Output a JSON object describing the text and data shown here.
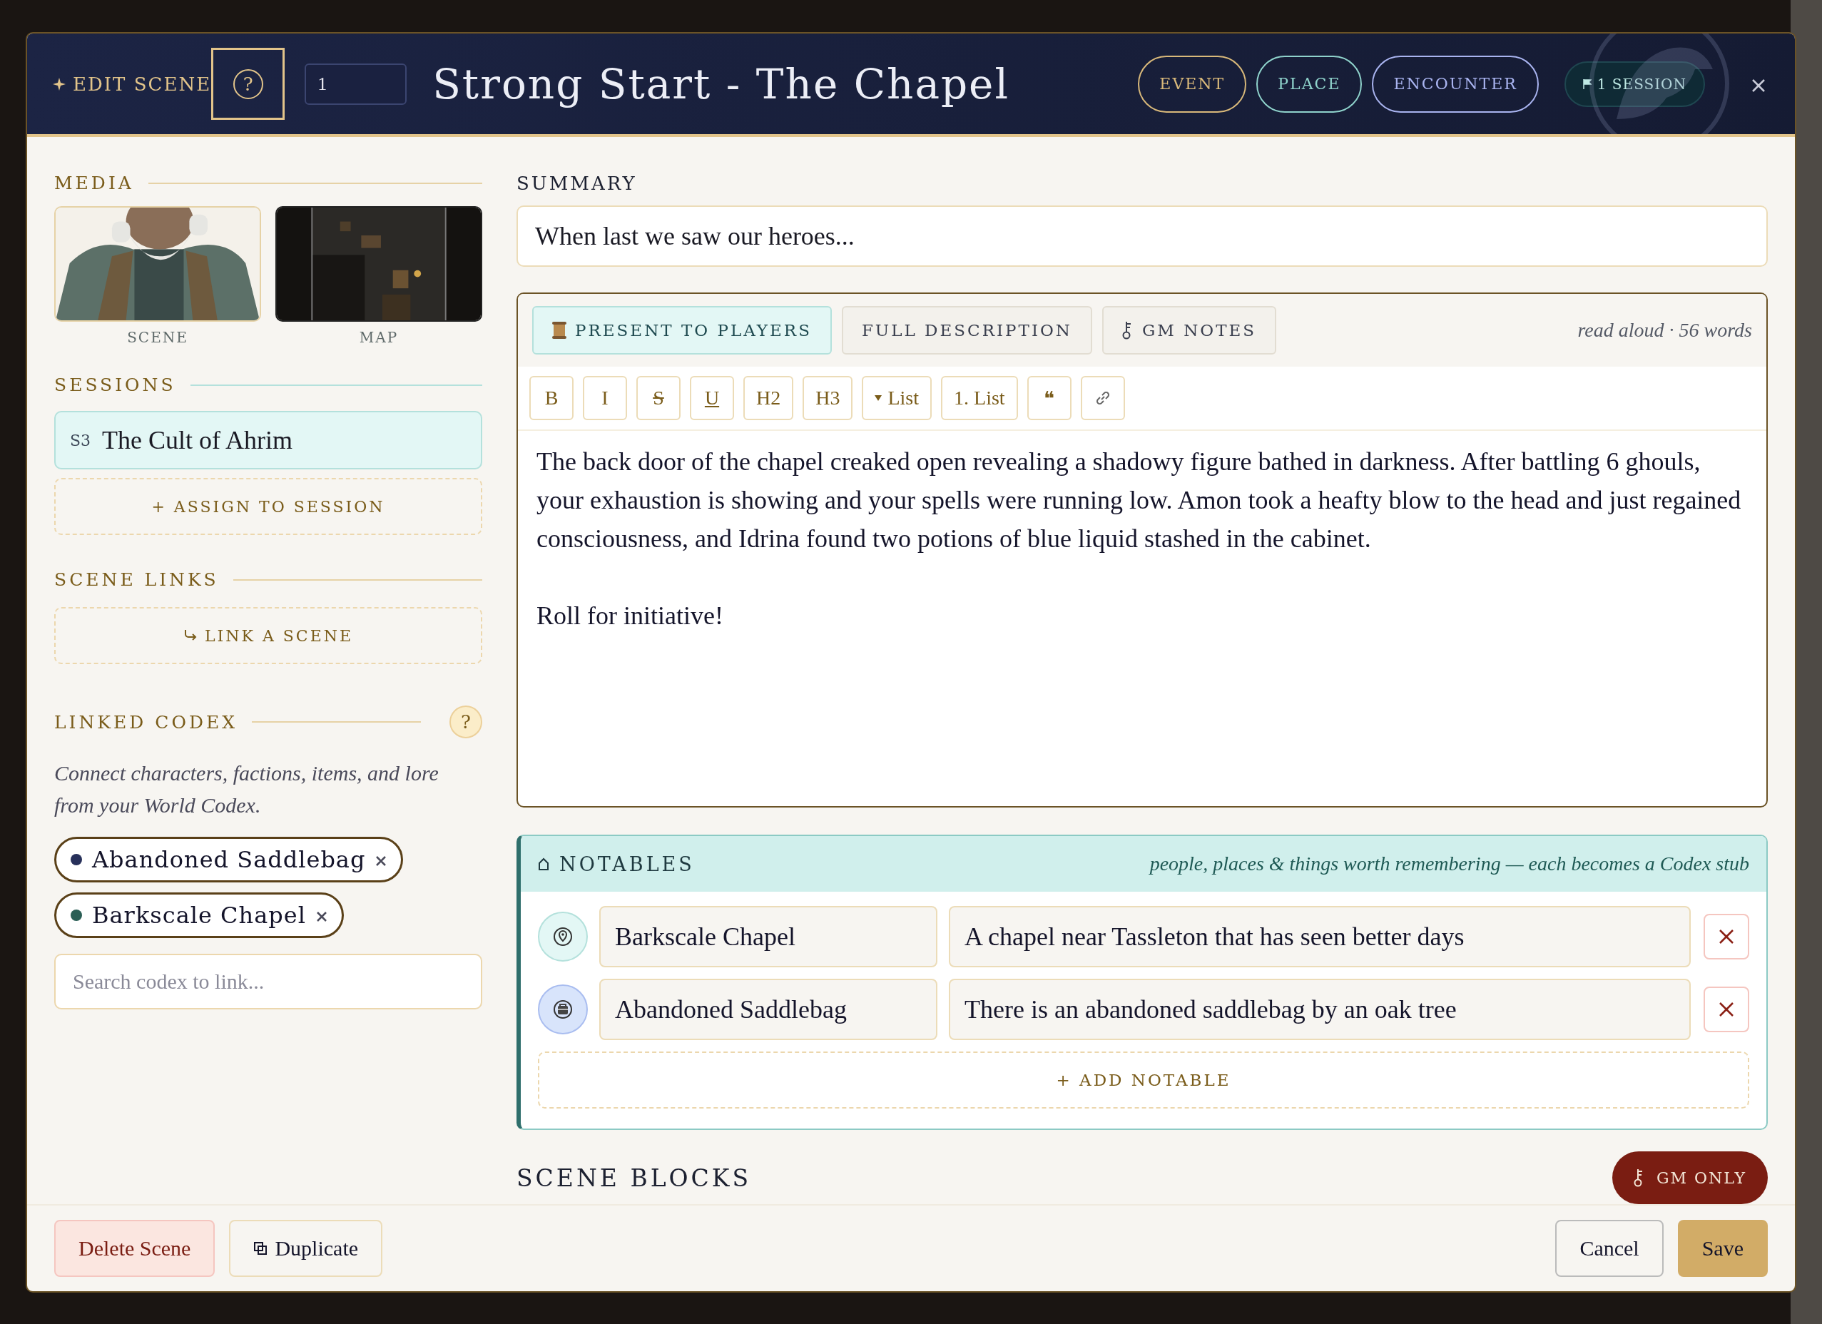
{
  "header": {
    "label": "EDIT SCENE",
    "help": "?",
    "scene_number": "1",
    "title": "Strong Start - The Chapel",
    "tags": [
      {
        "label": "EVENT",
        "color": "#d9b97a"
      },
      {
        "label": "PLACE",
        "color": "#8fd3cc"
      },
      {
        "label": "ENCOUNTER",
        "color": "#a9b4f0"
      }
    ],
    "session_badge": "1 SESSION"
  },
  "media": {
    "title": "MEDIA",
    "items": [
      {
        "caption": "SCENE",
        "kind": "portrait"
      },
      {
        "caption": "MAP",
        "kind": "map"
      }
    ]
  },
  "sessions": {
    "title": "SESSIONS",
    "items": [
      {
        "number": "S3",
        "name": "The Cult of Ahrim"
      }
    ],
    "assign_button": "+ ASSIGN TO SESSION"
  },
  "scene_links": {
    "title": "SCENE LINKS",
    "button": "LINK A SCENE"
  },
  "linked_codex": {
    "title": "LINKED CODEX",
    "help": "?",
    "description": "Connect characters, factions, items, and lore from your World Codex.",
    "chips": [
      {
        "label": "Abandoned Saddlebag",
        "color": "#27305a"
      },
      {
        "label": "Barkscale Chapel",
        "color": "#2a5e55"
      }
    ],
    "search": {
      "placeholder": "Search codex to link..."
    }
  },
  "summary": {
    "label": "SUMMARY",
    "value": "When last we saw our heroes..."
  },
  "editor": {
    "tabs": [
      {
        "label": "PRESENT TO PLAYERS",
        "kind": "scroll",
        "selected": true
      },
      {
        "label": "FULL DESCRIPTION",
        "selected": false
      },
      {
        "label": "GM NOTES",
        "kind": "key",
        "selected": false
      }
    ],
    "meta": "read aloud · 56 words",
    "toolbar": [
      {
        "kind": "text",
        "label": "B"
      },
      {
        "kind": "text",
        "label": "I"
      },
      {
        "kind": "strike",
        "label": "S"
      },
      {
        "kind": "underline",
        "label": "U"
      },
      {
        "kind": "text",
        "label": "H2"
      },
      {
        "kind": "text",
        "label": "H3"
      },
      {
        "kind": "bullets",
        "label": "List"
      },
      {
        "kind": "text",
        "label": "1. List"
      },
      {
        "kind": "text",
        "label": "❝"
      },
      {
        "kind": "link"
      }
    ],
    "paragraphs": [
      "The back door of the chapel creaked open revealing a shadowy figure bathed in darkness. After battling 6 ghouls, your exhaustion is showing and your spells were running low. Amon took a heafty blow to the head and just regained consciousness, and Idrina found two potions of blue liquid stashed in the cabinet.",
      "Roll for initiative!"
    ]
  },
  "notables": {
    "title": "NOTABLES",
    "hint": "people, places & things worth remembering — each becomes a Codex stub",
    "rows": [
      {
        "kind": "place",
        "name": "Barkscale Chapel",
        "description": "A chapel near Tassleton that has seen better days"
      },
      {
        "kind": "item",
        "name": "Abandoned Saddlebag",
        "description": "There is an abandoned saddlebag by an oak tree"
      }
    ],
    "add_button": "+ ADD NOTABLE"
  },
  "scene_blocks": {
    "title": "SCENE BLOCKS",
    "gm_button": "GM ONLY"
  },
  "footer": {
    "delete": "Delete Scene",
    "duplicate": "Duplicate",
    "cancel": "Cancel",
    "save": "Save"
  }
}
